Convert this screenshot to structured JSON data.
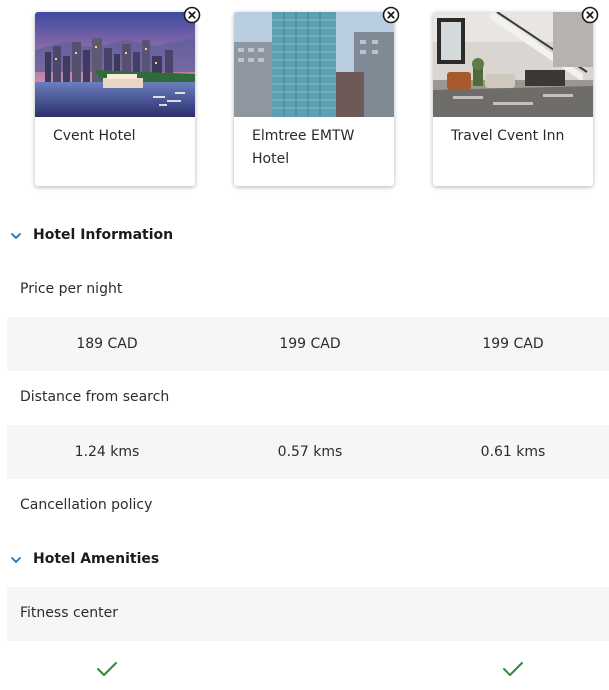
{
  "hotels": [
    {
      "name": "Cvent Hotel",
      "photo_icon": "harbor-skyline-photo",
      "remove_icon": "close-circle-icon"
    },
    {
      "name": "Elmtree EMTW Hotel",
      "photo_icon": "glass-tower-photo",
      "remove_icon": "close-circle-icon"
    },
    {
      "name": "Travel Cvent Inn",
      "photo_icon": "hotel-lobby-photo",
      "remove_icon": "close-circle-icon"
    }
  ],
  "sections": {
    "information": {
      "title": "Hotel Information",
      "chevron_icon": "chevron-down-icon",
      "rows": {
        "price": {
          "label": "Price per night",
          "values": [
            "189 CAD",
            "199 CAD",
            "199 CAD"
          ]
        },
        "distance": {
          "label": "Distance from search",
          "values": [
            "1.24 kms",
            "0.57 kms",
            "0.61 kms"
          ]
        },
        "cancellation": {
          "label": "Cancellation policy"
        }
      }
    },
    "amenities": {
      "title": "Hotel Amenities",
      "chevron_icon": "chevron-down-icon",
      "rows": {
        "fitness": {
          "label": "Fitness center",
          "available": [
            true,
            false,
            true
          ]
        }
      }
    }
  },
  "colors": {
    "accent": "#1a73b8",
    "check": "#2e8b3a",
    "row_shade": "#f5f6f7",
    "text": "#2c2c2c"
  }
}
